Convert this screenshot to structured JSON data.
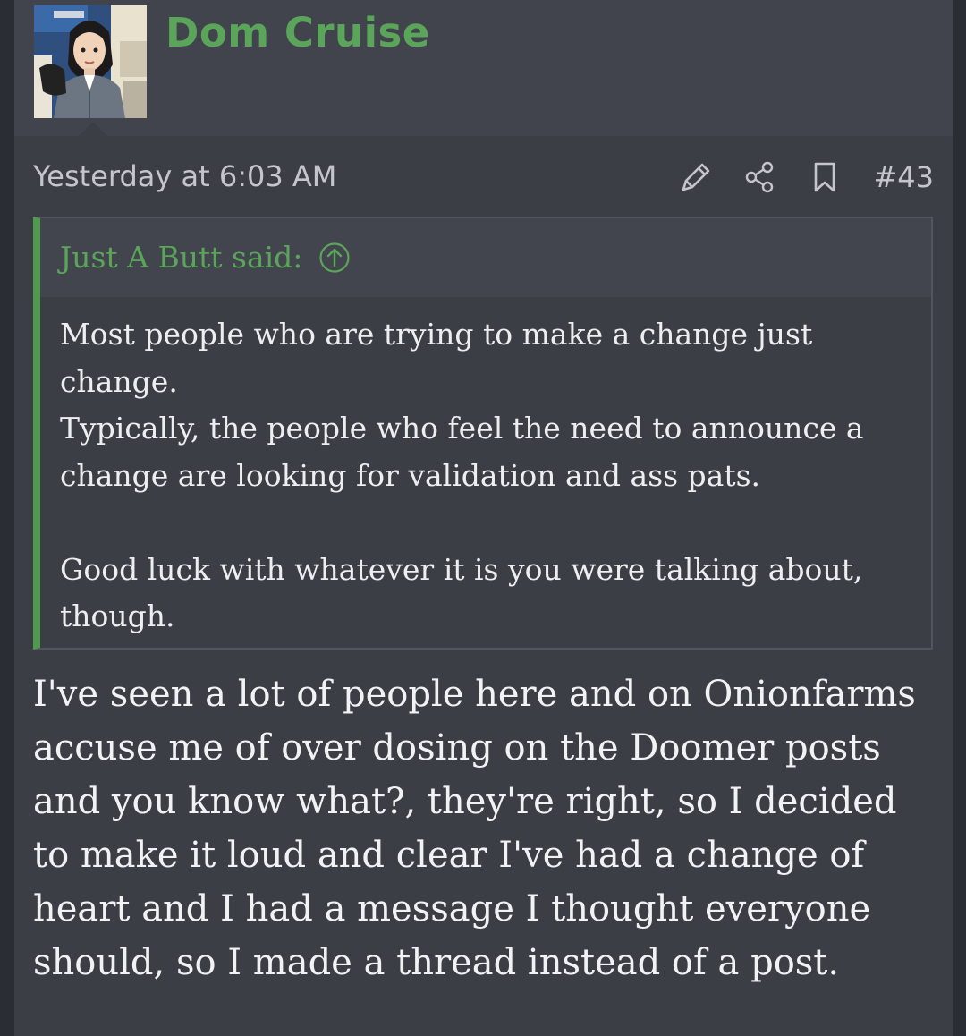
{
  "post": {
    "author": "Dom Cruise",
    "timestamp": "Yesterday at 6:03 AM",
    "post_number": "#43",
    "icons": {
      "edit": "pencil-icon",
      "share": "share-icon",
      "bookmark": "bookmark-icon",
      "quote_jump": "arrow-up-circle-icon"
    },
    "quote": {
      "author_label": "Just A Butt said:",
      "lines": [
        "Most people who are trying to make a change just change.",
        "Typically, the people who feel the need to announce a change are looking for validation and ass pats.",
        "Good luck with whatever it is you were talking about, though."
      ]
    },
    "message": "I've seen a lot of people here and on Onionfarms accuse me of over dosing on the Doomer posts and you know what?, they're right, so I decided to make it loud and clear I've had a change of heart and I had a message I thought everyone should, so I made a thread instead of a post."
  },
  "colors": {
    "background": "#3b3e45",
    "header": "#41444c",
    "accent_green": "#5aa55a",
    "text": "#eceef0",
    "muted": "#c4c6cb"
  }
}
